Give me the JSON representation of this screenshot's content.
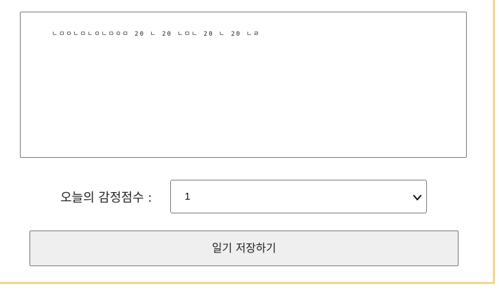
{
  "diary": {
    "content": "ㄴㅁㅇㄴㅁㄴㅇㄴㅁㅇㅁ 20 ㄴ 20 ㄴㅁㄴ 20 ㄴ 20 ㄴㄹ"
  },
  "emotion": {
    "label": "오늘의 감정점수 :",
    "selected": "1"
  },
  "actions": {
    "save_label": "일기 저장하기"
  },
  "icons": {
    "resize": "resize-grip-icon",
    "dropdown": "chevron-down-icon"
  }
}
